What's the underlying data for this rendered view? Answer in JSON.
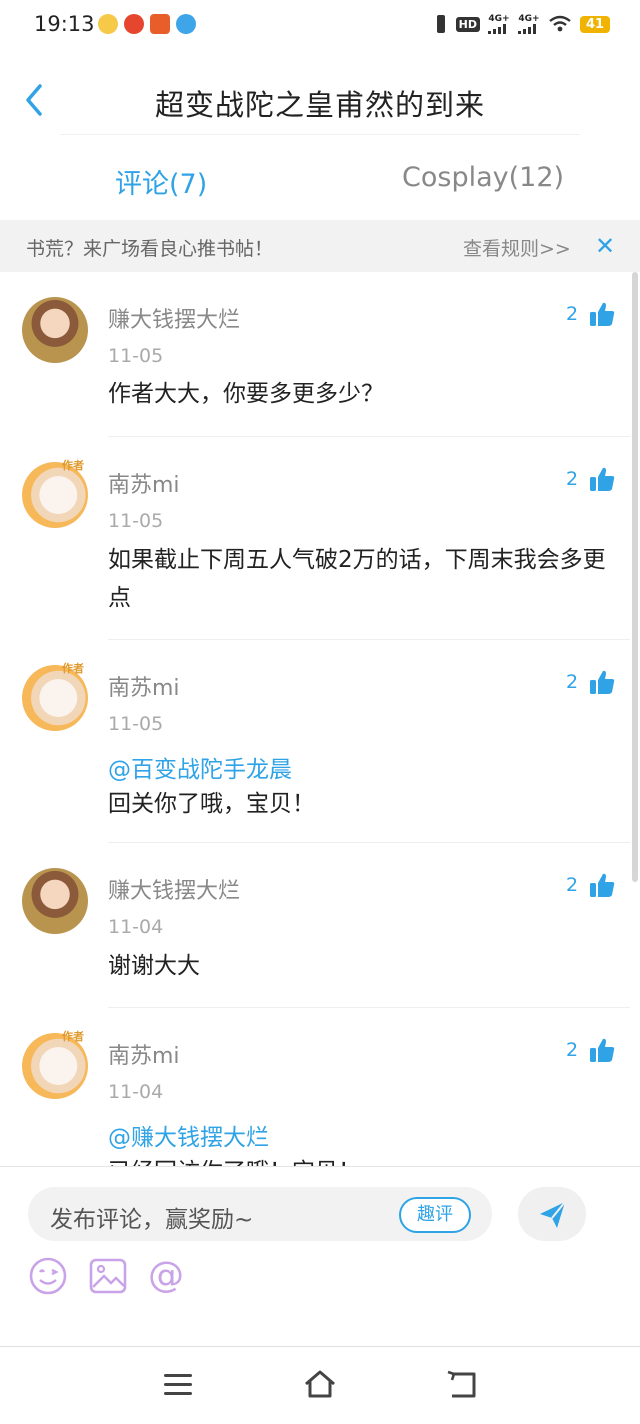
{
  "status_bar": {
    "time": "19:13",
    "signal_1": "4G+",
    "signal_2": "4G+",
    "hd": "HD",
    "battery": "41"
  },
  "header": {
    "title": "超变战陀之皇甫然的到来"
  },
  "tabs": [
    {
      "label": "评论(7)",
      "active": true
    },
    {
      "label": "Cosplay(12)",
      "active": false
    }
  ],
  "notice": {
    "text": "书荒？来广场看良心推书帖！",
    "rules_link": "查看规则>>",
    "close": "✕"
  },
  "comments": [
    {
      "user": "赚大钱摆大烂",
      "date": "11-05",
      "likes": "2",
      "mention": "",
      "text": "作者大大，你要多更多少？"
    },
    {
      "user": "南苏mi",
      "date": "11-05",
      "likes": "2",
      "mention": "",
      "text": "如果截止下周五人气破2万的话，下周末我会多更点"
    },
    {
      "user": "南苏mi",
      "date": "11-05",
      "likes": "2",
      "mention": "@百变战陀手龙晨",
      "text": "回关你了哦，宝贝！"
    },
    {
      "user": "赚大钱摆大烂",
      "date": "11-04",
      "likes": "2",
      "mention": "",
      "text": "谢谢大大"
    },
    {
      "user": "南苏mi",
      "date": "11-04",
      "likes": "2",
      "mention": "@赚大钱摆大烂",
      "text": "已经回访你了哦！宝贝！"
    }
  ],
  "author_badge": "作者",
  "input": {
    "placeholder": "发布评论，赢奖励~",
    "quping_label": "趣评",
    "tools": {
      "at_symbol": "@"
    }
  },
  "colors": {
    "accent": "#2fa3e6",
    "notice_bg": "#f2f2f2",
    "tool_purple": "#c9a3e8"
  }
}
